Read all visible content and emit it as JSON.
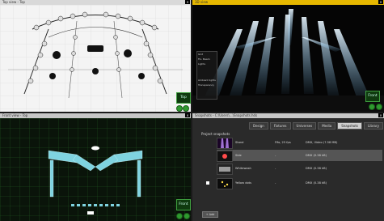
{
  "panes": {
    "top": {
      "title": "Top view - Top",
      "view_button": "Top"
    },
    "three_d": {
      "title": "3D view",
      "view_button": "Front",
      "panel": {
        "grid_label": "Grid",
        "fixtures_label": "Fix. Beam",
        "lights_label": "Lights",
        "ambient_label": "Ambient lights",
        "transparency_label": "Transparency"
      }
    },
    "front": {
      "title": "Front view - Top",
      "view_button": "Front"
    },
    "snapshots": {
      "title": "Snapshots - C:\\Users\\...\\Snapshots.hds",
      "tabs": [
        "Design",
        "Fixtures",
        "Universes",
        "Media",
        "Snapshots",
        "Library"
      ],
      "active_tab": "Snapshots",
      "header": "Project snapshots",
      "rows": [
        {
          "name": "Stand",
          "info": "Fifo, 25 fps",
          "size": "DMX, Video (7.58 MB)"
        },
        {
          "name": "Side",
          "info": "-",
          "size": "DMX (0.38 kB)"
        },
        {
          "name": "Whitewash",
          "info": "-",
          "size": "DMX (0.38 kB)"
        },
        {
          "name": "Yellow dots",
          "info": "-",
          "size": "DMX (0.38 kB)"
        }
      ],
      "footer_button": "+ Add"
    }
  },
  "colors": {
    "accent": "#e6b800",
    "grid_green": "#1f5a1f",
    "beam": "#bfe6ff",
    "fixture_cyan": "#7fd3e0"
  }
}
